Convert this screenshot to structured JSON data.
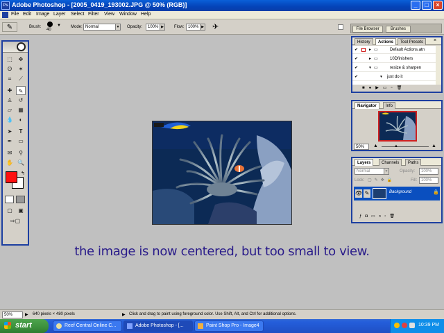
{
  "window": {
    "app_icon": "Ps",
    "title": "Adobe Photoshop - [2005_0419_193002.JPG @ 50% (RGB)]"
  },
  "menu": [
    "File",
    "Edit",
    "Image",
    "Layer",
    "Select",
    "Filter",
    "View",
    "Window",
    "Help"
  ],
  "options": {
    "brush_label": "Brush:",
    "brush_size": "40",
    "mode_label": "Mode:",
    "mode_value": "Normal",
    "opacity_label": "Opacity:",
    "opacity_value": "100%",
    "flow_label": "Flow:",
    "flow_value": "100%"
  },
  "palette_well": {
    "tabs": [
      "File Browser",
      "Brushes"
    ]
  },
  "actions_panel": {
    "tabs": [
      "History",
      "Actions",
      "Tool Presets"
    ],
    "rows": [
      "Default Actions.atn",
      "10Dfinishers",
      "resize & sharpen",
      "just do it"
    ]
  },
  "navigator_panel": {
    "tabs": [
      "Navigator",
      "Info"
    ],
    "zoom": "50%"
  },
  "layers_panel": {
    "tabs": [
      "Layers",
      "Channels",
      "Paths"
    ],
    "blend_mode": "Normal",
    "opacity_label": "Opacity:",
    "opacity_value": "100%",
    "lock_label": "Lock:",
    "fill_label": "Fill:",
    "fill_value": "100%",
    "layer_name": "Background"
  },
  "caption": "the image is now centered, but too small to view.",
  "status": {
    "zoom": "50%",
    "doc_size": "640 pixels × 480 pixels",
    "hint": "Click and drag to paint using foreground color. Use Shift, Alt, and Ctrl for additional options."
  },
  "taskbar": {
    "start": "start",
    "tasks": [
      "Reef Central Online C...",
      "Adobe Photoshop - [...",
      "Paint Shop Pro - Image4"
    ],
    "clock": "10:39 PM"
  },
  "colors": {
    "foreground": "#ff1010",
    "background": "#ffffff",
    "accent": "#1d3fa0"
  }
}
